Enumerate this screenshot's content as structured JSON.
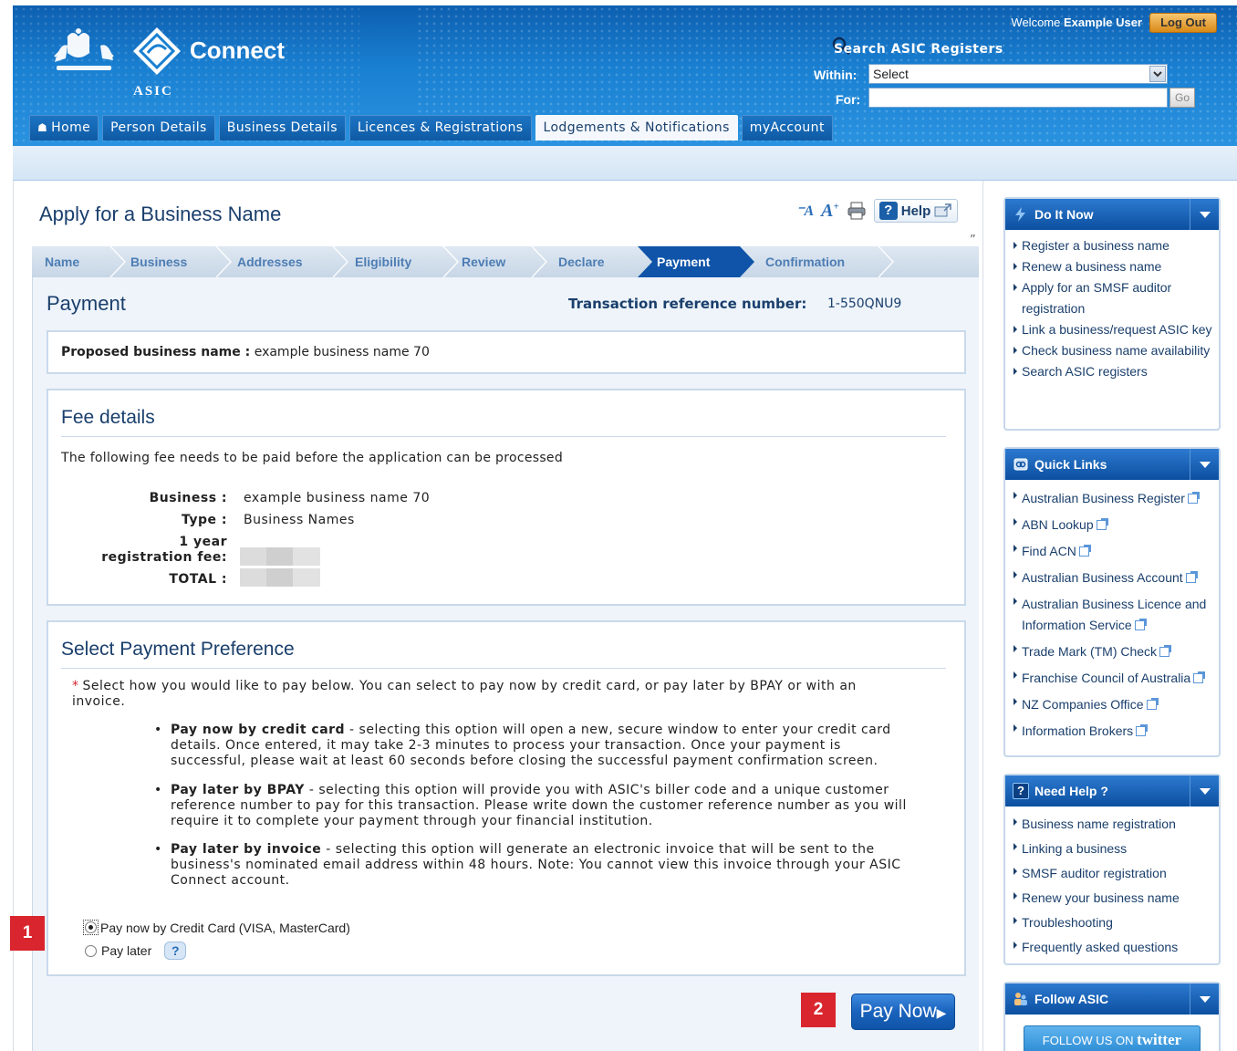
{
  "header": {
    "logo_text": "Connect",
    "org_text": "ASIC",
    "welcome_prefix": "Welcome",
    "user_name": "Example User",
    "logout_label": "Log Out",
    "search_title": "Search ASIC Registers",
    "within_label": "Within:",
    "within_value": "Select",
    "for_label": "For:",
    "for_value": "",
    "go_label": "Go"
  },
  "nav": {
    "tabs": [
      {
        "label": "Home"
      },
      {
        "label": "Person Details"
      },
      {
        "label": "Business Details"
      },
      {
        "label": "Licences & Registrations"
      },
      {
        "label": "Lodgements & Notifications"
      },
      {
        "label": "myAccount"
      }
    ],
    "active_tab": "Lodgements & Notifications"
  },
  "page": {
    "title": "Apply for a Business Name",
    "help_label": "Help"
  },
  "steps": {
    "items": [
      "Name",
      "Business",
      "Addresses",
      "Eligibility",
      "Review",
      "Declare",
      "Payment",
      "Confirmation"
    ],
    "active": "Payment"
  },
  "payment": {
    "title": "Payment",
    "tx_label": "Transaction reference number:",
    "tx_value": "1-550QNU9",
    "proposed_label": "Proposed business name :",
    "proposed_value": "example business name 70"
  },
  "fee": {
    "title": "Fee details",
    "description": "The following fee needs to be paid before the application can be processed",
    "business_label": "Business :",
    "business_value": "example business name 70",
    "type_label": "Type :",
    "type_value": "Business Names",
    "reg_fee_label_1": "1 year",
    "reg_fee_label_2": "registration fee:",
    "total_label": "TOTAL :"
  },
  "preference": {
    "title": "Select Payment Preference",
    "required_text": "Select how you would like to pay below. You can select to pay now by credit card, or pay later by BPAY or with an invoice.",
    "bullets": [
      {
        "bold": "Pay now by credit card",
        "text": " - selecting this option will open a new, secure window to enter your credit card details. Once entered, it may take 2-3 minutes to process your transaction. Once your payment is successful, please wait at least 60 seconds before closing the successful payment confirmation screen."
      },
      {
        "bold": "Pay later by BPAY",
        "text": " - selecting this option will provide you with ASIC's biller code and a unique customer reference number to pay for this transaction. Please write down the customer reference number as you will require it to complete your payment through your financial institution."
      },
      {
        "bold": "Pay later by invoice",
        "text": " - selecting this option will generate an electronic invoice that will be sent to the business's nominated email address within 48 hours. Note: You cannot view this invoice through your ASIC Connect account."
      }
    ],
    "option_pay_now": "Pay now by Credit Card (VISA, MasterCard)",
    "option_pay_later": "Pay later",
    "selected": "Pay now by Credit Card (VISA, MasterCard)",
    "pay_now_button": "Pay Now"
  },
  "badges": {
    "one": "1",
    "two": "2"
  },
  "sidebar": {
    "do_it_now": {
      "title": "Do It Now",
      "items": [
        "Register a business name",
        "Renew a business name",
        "Apply for an SMSF auditor registration",
        "Link a business/request ASIC key",
        "Check business name availability",
        "Search ASIC registers"
      ]
    },
    "quick_links": {
      "title": "Quick Links",
      "items": [
        "Australian Business Register",
        "ABN Lookup",
        "Find ACN",
        "Australian Business Account",
        "Australian Business Licence and Information Service",
        "Trade Mark (TM) Check",
        "Franchise Council of Australia",
        "NZ Companies Office",
        "Information Brokers"
      ]
    },
    "need_help": {
      "title": "Need Help ?",
      "items": [
        "Business name registration",
        "Linking a business",
        "SMSF auditor registration",
        "Renew your business name",
        "Troubleshooting",
        "Frequently asked questions"
      ]
    },
    "follow": {
      "title": "Follow ASIC",
      "twitter_prefix": "FOLLOW US ON",
      "twitter_word": "twitter"
    }
  },
  "colors": {
    "brand_blue": "#1a80d2",
    "heading_navy": "#1a3f6c",
    "badge_red": "#d9252e",
    "logout_orange": "#e9a13b"
  }
}
